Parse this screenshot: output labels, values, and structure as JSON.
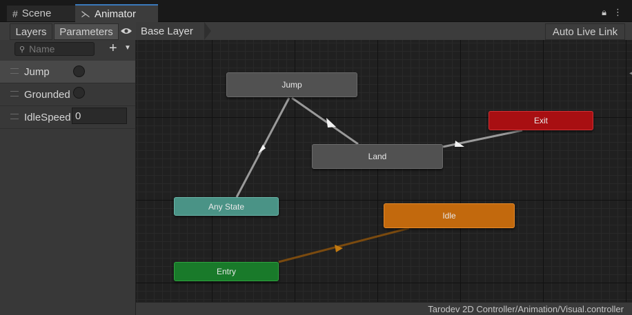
{
  "tabs": {
    "scene": {
      "label": "Scene",
      "icon": "grid-icon"
    },
    "animator": {
      "label": "Animator",
      "icon": "animator-icon"
    },
    "actions": {
      "lock_icon": "lock-icon",
      "menu_icon": "kebab-menu-icon"
    }
  },
  "toolbar": {
    "layers_label": "Layers",
    "parameters_label": "Parameters",
    "eye_icon": "eye-icon",
    "breadcrumb": "Base Layer",
    "auto_live_link_label": "Auto Live Link"
  },
  "parameters_panel": {
    "search_placeholder": "Name",
    "add_icon": "plus-icon",
    "items": [
      {
        "name": "Jump",
        "type": "trigger",
        "selected": true
      },
      {
        "name": "Grounded",
        "type": "bool",
        "selected": false
      },
      {
        "name": "IdleSpeed",
        "type": "float",
        "value": "0",
        "selected": false
      }
    ]
  },
  "graph": {
    "states": [
      {
        "id": "jump",
        "label": "Jump",
        "color": "#515151"
      },
      {
        "id": "land",
        "label": "Land",
        "color": "#515151"
      },
      {
        "id": "exit",
        "label": "Exit",
        "color": "#a80f12"
      },
      {
        "id": "any",
        "label": "Any State",
        "color": "#4a9386"
      },
      {
        "id": "idle",
        "label": "Idle",
        "color": "#c2690d"
      },
      {
        "id": "entry",
        "label": "Entry",
        "color": "#197a2a"
      }
    ],
    "transitions": [
      {
        "from": "any",
        "to": "jump"
      },
      {
        "from": "jump",
        "to": "land"
      },
      {
        "from": "land",
        "to": "exit"
      },
      {
        "from": "entry",
        "to": "idle",
        "color": "#7a4a0f"
      }
    ]
  },
  "status_bar": {
    "path": "Tarodev 2D Controller/Animation/Visual.controller"
  }
}
